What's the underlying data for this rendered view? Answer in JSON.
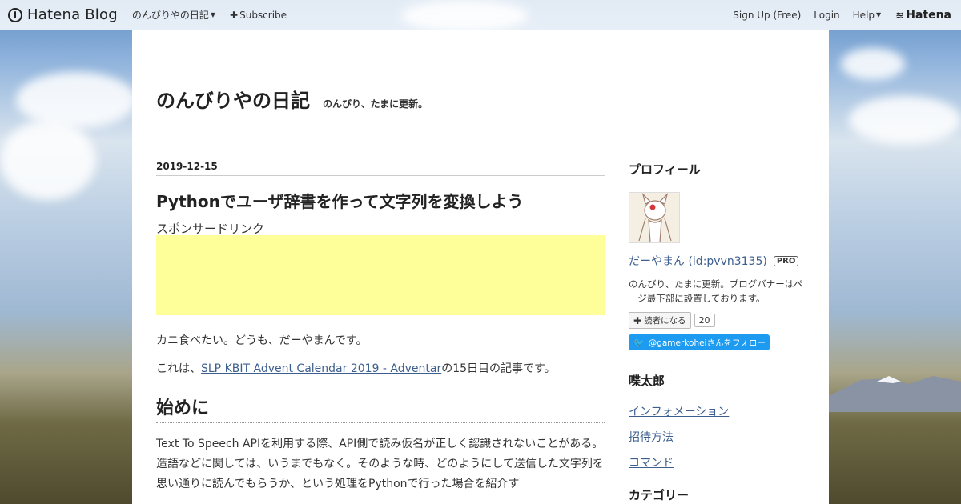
{
  "global_header": {
    "logo_text": "Hatena Blog",
    "blog_menu_label": "のんびりやの日記",
    "subscribe_label": "Subscribe",
    "signup_label": "Sign Up (Free)",
    "login_label": "Login",
    "help_label": "Help",
    "brand_label": "Hatena"
  },
  "blog": {
    "title": "のんびりやの日記",
    "description": "のんびり、たまに更新。"
  },
  "entry": {
    "date": "2019-12-15",
    "title": "Pythonでユーザ辞書を作って文字列を変換しよう",
    "sponsor_label": "スポンサードリンク",
    "para1": "カニ食べたい。どうも、だーやまんです。",
    "para2_prefix": "これは、",
    "para2_link": "SLP KBIT Advent Calendar 2019 - Adventar",
    "para2_suffix": "の15日目の記事です。",
    "heading": "始めに",
    "body": "Text To Speech APIを利用する際、API側で読み仮名が正しく認識されないことがある。造語などに関しては、いうまでもなく。そのような時、どのようにして送信した文字列を思い通りに読んでもらうか、という処理をPythonで行った場合を紹介す"
  },
  "sidebar": {
    "profile_heading": "プロフィール",
    "profile_name": "だーやまん (id:pvvn3135)",
    "pro_badge": "PRO",
    "profile_desc": "のんびり、たまに更新。ブログバナーはページ最下部に設置しております。",
    "reader_button": "読者になる",
    "reader_count": "20",
    "twitter_follow": "@gamerkoheiさんをフォロー",
    "section2_heading": "喋太郎",
    "section2_links": [
      "インフォメーション",
      "招待方法",
      "コマンド"
    ],
    "category_heading": "カテゴリー"
  },
  "colors": {
    "link": "#3d5f8f",
    "ad_background": "#ffff99",
    "twitter": "#1d9bf0"
  }
}
